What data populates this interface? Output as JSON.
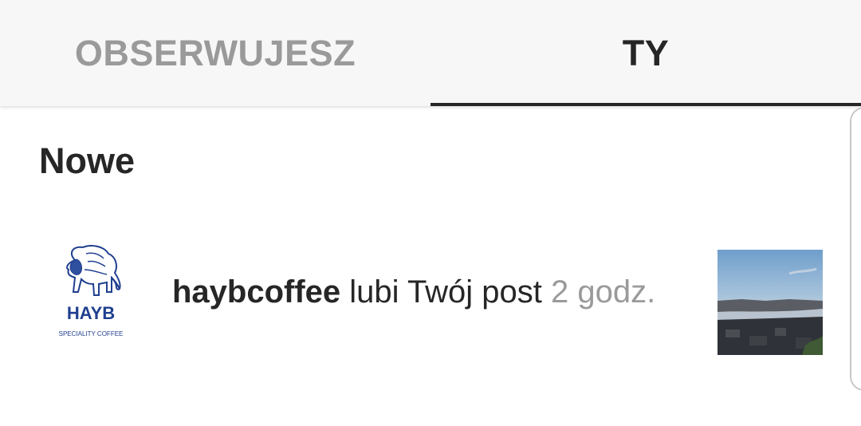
{
  "tabs": [
    {
      "label": "OBSERWUJESZ",
      "active": false
    },
    {
      "label": "TY",
      "active": true
    }
  ],
  "section": {
    "title": "Nowe"
  },
  "notifications": [
    {
      "avatar": {
        "brand": "HAYB",
        "tagline": "SPECIALITY COFFEE",
        "icon": "elephant-icon"
      },
      "username": "haybcoffee",
      "action": " lubi Twój post ",
      "time": "2 godz."
    }
  ],
  "colors": {
    "text_primary": "#262626",
    "text_secondary": "#9a9a9a",
    "tab_background": "#f7f7f7",
    "brand_blue": "#1f3f8f"
  }
}
